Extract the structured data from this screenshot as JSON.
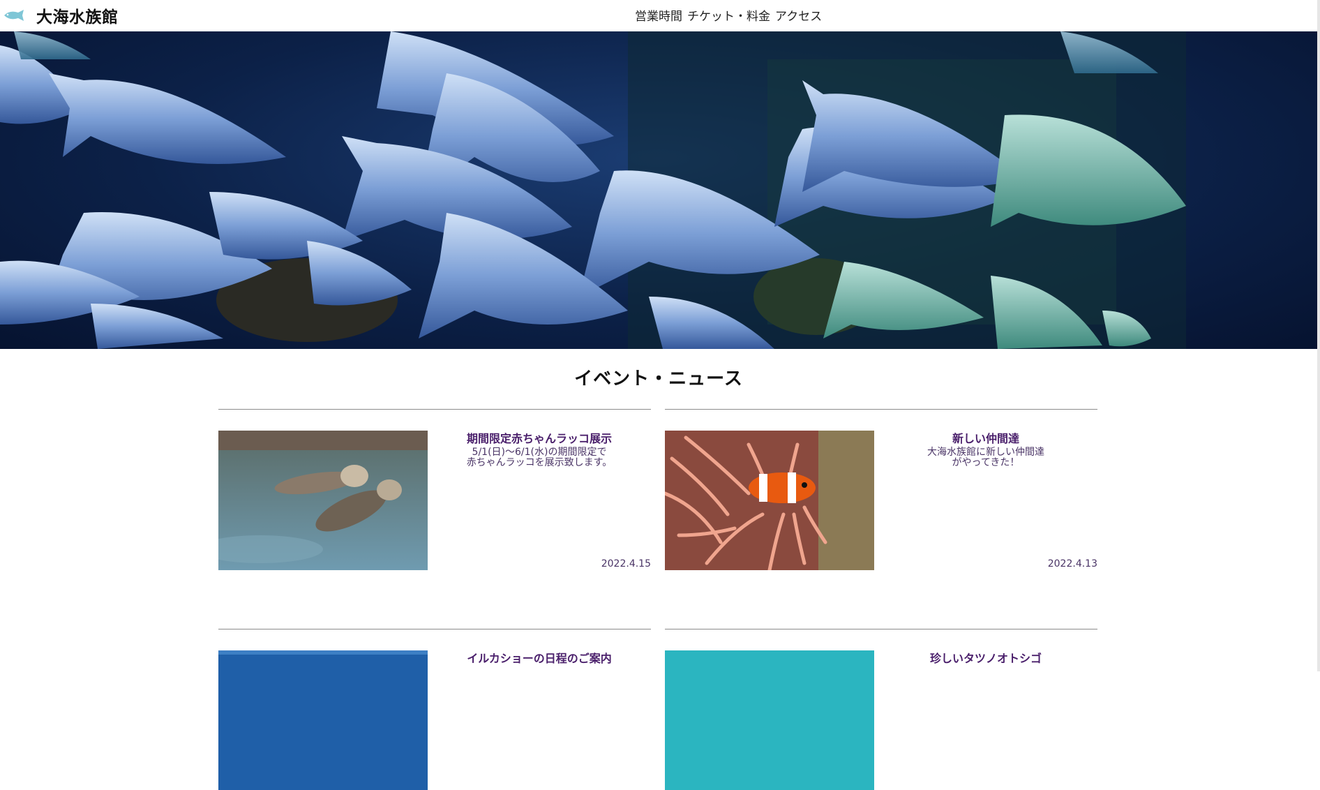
{
  "header": {
    "logo_icon": "fish-icon",
    "site_title": "大海水族館",
    "nav": [
      "営業時間",
      "チケット・料金",
      "アクセス"
    ]
  },
  "hero": {
    "image": "school-of-fish-photo"
  },
  "section": {
    "title": "イベント・ニュース"
  },
  "news": [
    {
      "title": "期間限定赤ちゃんラッコ展示",
      "desc": "5/1(日)〜6/1(水)の期間限定で\n赤ちゃんラッコを展示致します。",
      "date": "2022.4.15",
      "image": "sea-otters-photo"
    },
    {
      "title": "新しい仲間達",
      "desc": "大海水族館に新しい仲間達\nがやってきた！",
      "date": "2022.4.13",
      "image": "clownfish-photo"
    },
    {
      "title": "イルカショーの日程のご案内",
      "desc": "",
      "date": "",
      "image": "dolphin-water-photo"
    },
    {
      "title": "珍しいタツノオトシゴ",
      "desc": "",
      "date": "",
      "image": "seahorse-photo"
    }
  ],
  "colors": {
    "title_purple": "#4a1f6b",
    "text_purple": "#4a3466",
    "rule_gray": "#8c8c8c"
  }
}
